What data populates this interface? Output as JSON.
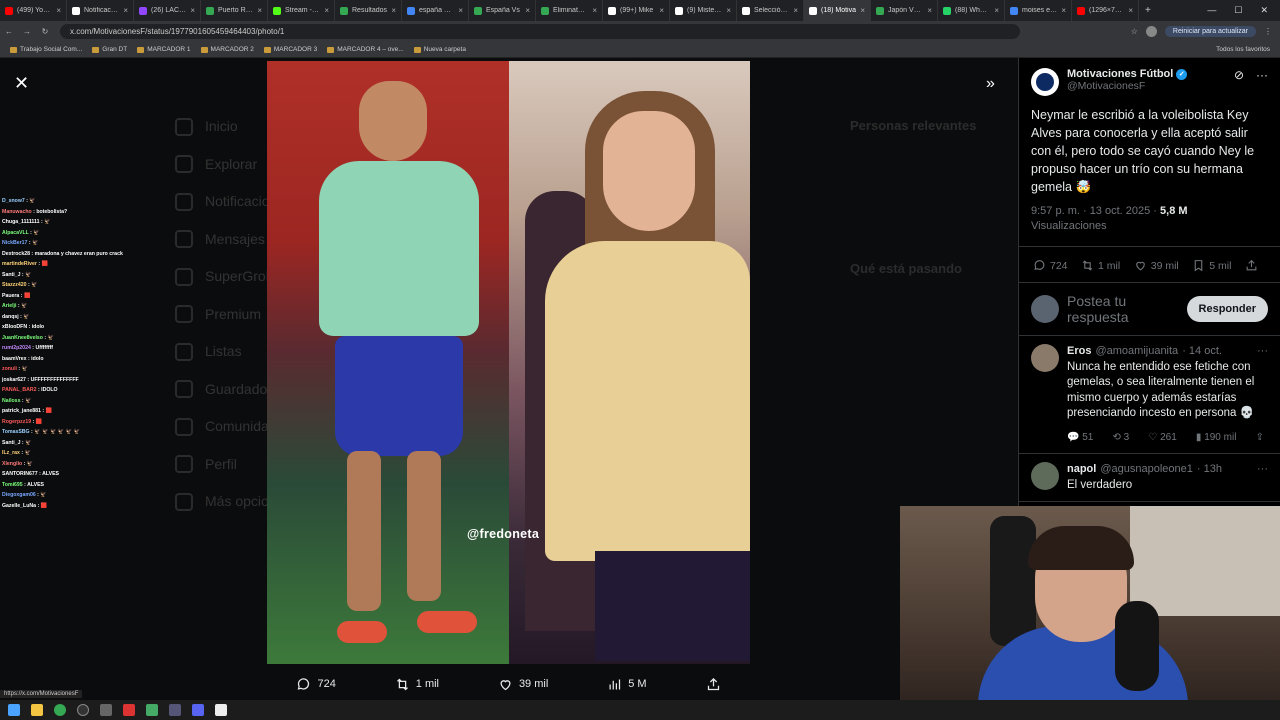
{
  "browser": {
    "tabs": [
      {
        "label": "(499) YouTube",
        "color": "#ff0000"
      },
      {
        "label": "Notificaciones",
        "color": "#ffffff"
      },
      {
        "label": "(26) LACOBRAA",
        "color": "#9146ff"
      },
      {
        "label": "Puerto Rico",
        "color": "#34a853"
      },
      {
        "label": "Stream - Kick",
        "color": "#53fc18"
      },
      {
        "label": "Resultados",
        "color": "#34a853"
      },
      {
        "label": "españa ultim",
        "color": "#4285f4"
      },
      {
        "label": "España Vs",
        "color": "#34a853"
      },
      {
        "label": "Eliminatorias",
        "color": "#34a853"
      },
      {
        "label": "(99+) Mike",
        "color": "#ffffff"
      },
      {
        "label": "(9) MisterCh",
        "color": "#ffffff"
      },
      {
        "label": "Selección de",
        "color": "#ffffff"
      },
      {
        "label": "(18) Motiva",
        "color": "#ffffff"
      },
      {
        "label": "Japón Vs B",
        "color": "#34a853"
      },
      {
        "label": "(88) WhatsA",
        "color": "#25d366"
      },
      {
        "label": "moises ecua",
        "color": "#4285f4"
      },
      {
        "label": "(1296×720)",
        "color": "#ff0000"
      }
    ],
    "url": "x.com/MotivacionesF/status/1977901605459464403/photo/1",
    "update_button": "Reiniciar para actualizar",
    "bookmarks": [
      "Trabajo Social Com...",
      "Gran DT",
      "MARCADOR 1",
      "MARCADOR 2",
      "MARCADOR 3",
      "MARCADOR 4 – ove...",
      "Nueva carpeta"
    ],
    "all_bookmarks": "Todos los favoritos",
    "status_url": "https://x.com/MotivacionesF"
  },
  "background": {
    "nav": [
      "Inicio",
      "Explorar",
      "Notificaciones",
      "Mensajes",
      "SuperGrok",
      "Premium",
      "Listas",
      "Guardados",
      "Comunidades",
      "Perfil",
      "Más opciones"
    ],
    "relevant_title": "Personas relevantes",
    "trending_title": "Qué está pasando"
  },
  "chat": [
    {
      "user": "D_snow7",
      "msg": "🦅",
      "color": "#9ad0ff"
    },
    {
      "user": "Manuwacho",
      "msg": "botebolista?",
      "color": "#ff7a7a"
    },
    {
      "user": "Chuga_1111111",
      "msg": "🦅",
      "color": "#ffffff"
    },
    {
      "user": "AlpacaVLL",
      "msg": "🦅",
      "color": "#7cff7c"
    },
    {
      "user": "NickBer17",
      "msg": "🦅",
      "color": "#7aa8ff"
    },
    {
      "user": "Dextrock28",
      "msg": "maradona y chavez eran puro crack",
      "color": "#ffffff"
    },
    {
      "user": "martindeRiver",
      "msg": "🟥",
      "color": "#ffd37a"
    },
    {
      "user": "Santi_J",
      "msg": "🦅",
      "color": "#ffffff"
    },
    {
      "user": "Stazzz420",
      "msg": "🦅",
      "color": "#ffd37a"
    },
    {
      "user": "Pauera",
      "msg": "🟥",
      "color": "#ffffff"
    },
    {
      "user": "Arielji",
      "msg": "🦅",
      "color": "#7cff7c"
    },
    {
      "user": "danqsj",
      "msg": "🦅",
      "color": "#ffffff"
    },
    {
      "user": "xBlooDFN",
      "msg": "idolo",
      "color": "#ffffff"
    },
    {
      "user": "JuanKnee8velso",
      "msg": "🦅",
      "color": "#7cff7c"
    },
    {
      "user": "rumi2p2024",
      "msg": "Uffffffff",
      "color": "#c58cff"
    },
    {
      "user": "baamVrex",
      "msg": "idolo",
      "color": "#ffffff"
    },
    {
      "user": "zonuli",
      "msg": "🦅",
      "color": "#ff5a5a"
    },
    {
      "user": "joskar627",
      "msg": "UFFFFFFFFFFFFFF",
      "color": "#ffffff"
    },
    {
      "user": "PANAL_BAR2",
      "msg": "IDOLO",
      "color": "#ff5a5a"
    },
    {
      "user": "Nailoss",
      "msg": "🦅",
      "color": "#7cff7c"
    },
    {
      "user": "patrick_jane881",
      "msg": "🟥",
      "color": "#ffffff"
    },
    {
      "user": "Rogerpzz19",
      "msg": "🟥",
      "color": "#ff5a5a"
    },
    {
      "user": "TomasSBG",
      "msg": "🦅 🦅 🦅 🦅 🦅 🦅",
      "color": "#9ad0ff"
    },
    {
      "user": "Santi_J",
      "msg": "🦅",
      "color": "#ffffff"
    },
    {
      "user": "lLz_rax",
      "msg": "🦅",
      "color": "#ffd37a"
    },
    {
      "user": "Xlenglio",
      "msg": "🦅",
      "color": "#ff7a7a"
    },
    {
      "user": "SANTORIN677",
      "msg": "ALVES",
      "color": "#ffffff"
    },
    {
      "user": "Tomi695",
      "msg": "ALVES",
      "color": "#7cff7c"
    },
    {
      "user": "Diegoxgam06",
      "msg": "🦅",
      "color": "#7aa8ff"
    },
    {
      "user": "Gazelle_LuNa",
      "msg": "🟥",
      "color": "#ffffff"
    }
  ],
  "photo": {
    "watermark": "@fredoneta",
    "stats": {
      "replies": "724",
      "reposts": "1 mil",
      "likes": "39 mil",
      "views": "5 M"
    }
  },
  "tweet": {
    "name": "Motivaciones Fútbol",
    "handle": "@MotivacionesF",
    "text": "Neymar le escribió a la voleibolista Key Alves para conocerla y ella aceptó salir con él, pero todo se cayó cuando Ney le propuso hacer un trío con su hermana gemela 🤯",
    "time": "9:57 p. m. · 13 oct. 2025 ·",
    "views_count": "5,8 M",
    "views_label": "Visualizaciones",
    "replies": "724",
    "reposts": "1 mil",
    "likes": "39 mil",
    "bookmarks": "5 mil"
  },
  "reply_box": {
    "placeholder": "Postea tu respuesta",
    "button": "Responder"
  },
  "comments": [
    {
      "name": "Eros",
      "handle": "@amoamijuanita",
      "date": "· 14 oct.",
      "text": "Nunca he entendido ese fetiche con gemelas, o sea literalmente tienen el mismo cuerpo y además estarías presenciando incesto en persona 💀",
      "replies": "51",
      "reposts": "3",
      "likes": "261",
      "views": "190 mil"
    },
    {
      "name": "napol",
      "handle": "@agusnapoleone1",
      "date": "· 13h",
      "text": "El verdadero"
    }
  ]
}
